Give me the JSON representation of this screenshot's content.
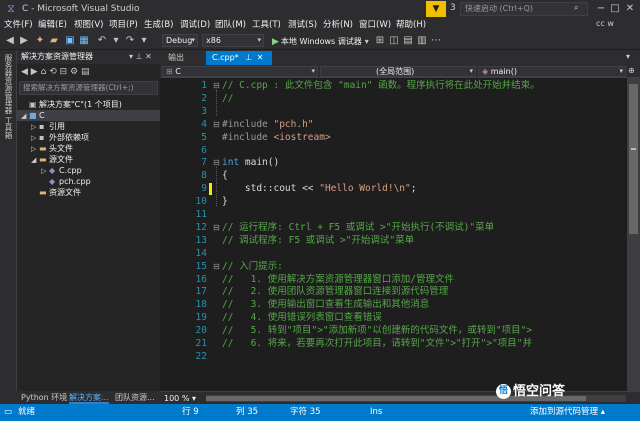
{
  "window": {
    "title": "C - Microsoft Visual Studio",
    "quick_launch_placeholder": "快速启动 (Ctrl+Q)",
    "notification_count": "3"
  },
  "menu": {
    "items": [
      "文件(F)",
      "编辑(E)",
      "视图(V)",
      "项目(P)",
      "生成(B)",
      "调试(D)",
      "团队(M)",
      "工具(T)",
      "测试(S)",
      "分析(N)",
      "窗口(W)",
      "帮助(H)"
    ],
    "user": "cc w"
  },
  "toolbar": {
    "config": "Debug",
    "platform": "x86",
    "run_label": "本地 Windows 调试器"
  },
  "left_strip": {
    "labels": [
      "服务器资源管理器",
      "工具箱"
    ]
  },
  "solution_explorer": {
    "title": "解决方案资源管理器",
    "search_placeholder": "搜索解决方案资源管理器(Ctrl+;)",
    "tree": [
      {
        "label": "解决方案\"C\"(1 个项目)",
        "depth": 0,
        "expand": "",
        "icon": "solution-icon",
        "glyph": "▣",
        "color": "#c5c5c5"
      },
      {
        "label": "C",
        "depth": 0,
        "expand": "◢",
        "icon": "project-icon",
        "glyph": "■",
        "color": "#6fa8dc",
        "selected": true
      },
      {
        "label": "引用",
        "depth": 1,
        "expand": "▷",
        "icon": "references-icon",
        "glyph": "▪",
        "color": "#c5c5c5"
      },
      {
        "label": "外部依赖项",
        "depth": 1,
        "expand": "▷",
        "icon": "external-deps-icon",
        "glyph": "▪",
        "color": "#c5c5c5"
      },
      {
        "label": "头文件",
        "depth": 1,
        "expand": "▷",
        "icon": "folder-icon",
        "glyph": "▬",
        "color": "#dcb67a"
      },
      {
        "label": "源文件",
        "depth": 1,
        "expand": "◢",
        "icon": "folder-open-icon",
        "glyph": "▬",
        "color": "#dcb67a"
      },
      {
        "label": "C.cpp",
        "depth": 2,
        "expand": "▷",
        "icon": "cpp-file-icon",
        "glyph": "◆",
        "color": "#9b85d1"
      },
      {
        "label": "pch.cpp",
        "depth": 2,
        "expand": "",
        "icon": "cpp-file-icon",
        "glyph": "◆",
        "color": "#9b85d1"
      },
      {
        "label": "资源文件",
        "depth": 1,
        "expand": "",
        "icon": "folder-icon",
        "glyph": "▬",
        "color": "#dcb67a"
      }
    ],
    "bottom_tabs": [
      "Python 环境",
      "解决方案...",
      "团队资源..."
    ]
  },
  "editor": {
    "tabs": [
      {
        "label": "输出",
        "active": false
      },
      {
        "label": "C.cpp*",
        "active": true
      }
    ],
    "nav": {
      "project": "C",
      "scope": "(全局范围)",
      "member": "main()"
    },
    "zoom": "100 %",
    "lines": [
      {
        "n": "1",
        "fold": "⊟",
        "parts": [
          {
            "c": "cmt",
            "t": "// C.cpp : 此文件包含 \"main\" 函数。程序执行将在此处开始并结束。"
          }
        ]
      },
      {
        "n": "2",
        "fold": "",
        "parts": [
          {
            "c": "cmt",
            "t": "//"
          }
        ]
      },
      {
        "n": "3",
        "fold": "",
        "parts": []
      },
      {
        "n": "4",
        "fold": "⊟",
        "parts": [
          {
            "c": "pp",
            "t": "#include "
          },
          {
            "c": "str",
            "t": "\"pch.h\""
          }
        ]
      },
      {
        "n": "5",
        "fold": "",
        "parts": [
          {
            "c": "pp",
            "t": "#include "
          },
          {
            "c": "str",
            "t": "<iostream>"
          }
        ]
      },
      {
        "n": "6",
        "fold": "",
        "parts": []
      },
      {
        "n": "7",
        "fold": "⊟",
        "parts": [
          {
            "c": "kw",
            "t": "int"
          },
          {
            "c": "plain",
            "t": " main()"
          }
        ]
      },
      {
        "n": "8",
        "fold": "",
        "parts": [
          {
            "c": "plain",
            "t": "{"
          }
        ]
      },
      {
        "n": "9",
        "fold": "",
        "parts": [
          {
            "c": "plain",
            "t": "    std::cout << "
          },
          {
            "c": "str",
            "t": "\"Hello World!\\n\""
          },
          {
            "c": "plain",
            "t": ";"
          }
        ],
        "modified": true
      },
      {
        "n": "10",
        "fold": "",
        "parts": [
          {
            "c": "plain",
            "t": "}"
          }
        ]
      },
      {
        "n": "11",
        "fold": "",
        "parts": []
      },
      {
        "n": "12",
        "fold": "⊟",
        "parts": [
          {
            "c": "cmt",
            "t": "// 运行程序: Ctrl + F5 或调试 >\"开始执行(不调试)\"菜单"
          }
        ]
      },
      {
        "n": "13",
        "fold": "",
        "parts": [
          {
            "c": "cmt",
            "t": "// 调试程序: F5 或调试 >\"开始调试\"菜单"
          }
        ]
      },
      {
        "n": "14",
        "fold": "",
        "parts": []
      },
      {
        "n": "15",
        "fold": "⊟",
        "parts": [
          {
            "c": "cmt",
            "t": "// 入门提示:"
          }
        ]
      },
      {
        "n": "16",
        "fold": "",
        "parts": [
          {
            "c": "cmt",
            "t": "//   1. 使用解决方案资源管理器窗口添加/管理文件"
          }
        ]
      },
      {
        "n": "17",
        "fold": "",
        "parts": [
          {
            "c": "cmt",
            "t": "//   2. 使用团队资源管理器窗口连接到源代码管理"
          }
        ]
      },
      {
        "n": "18",
        "fold": "",
        "parts": [
          {
            "c": "cmt",
            "t": "//   3. 使用输出窗口查看生成输出和其他消息"
          }
        ]
      },
      {
        "n": "19",
        "fold": "",
        "parts": [
          {
            "c": "cmt",
            "t": "//   4. 使用错误列表窗口查看错误"
          }
        ]
      },
      {
        "n": "20",
        "fold": "",
        "parts": [
          {
            "c": "cmt",
            "t": "//   5. 转到\"项目\">\"添加新项\"以创建新的代码文件，或转到\"项目\">"
          }
        ]
      },
      {
        "n": "21",
        "fold": "",
        "parts": [
          {
            "c": "cmt",
            "t": "//   6. 将来，若要再次打开此项目，请转到\"文件\">\"打开\">\"项目\"并"
          }
        ]
      },
      {
        "n": "22",
        "fold": "",
        "parts": []
      }
    ]
  },
  "status": {
    "left": "就绪",
    "line": "行 9",
    "col": "列 35",
    "char": "字符 35",
    "mode": "Ins",
    "source_control": "添加到源代码管理"
  },
  "watermark": "悟空问答",
  "colors": {
    "accent": "#007acc",
    "editor_bg": "#1e1e1e",
    "chrome_bg": "#2d2d30"
  }
}
